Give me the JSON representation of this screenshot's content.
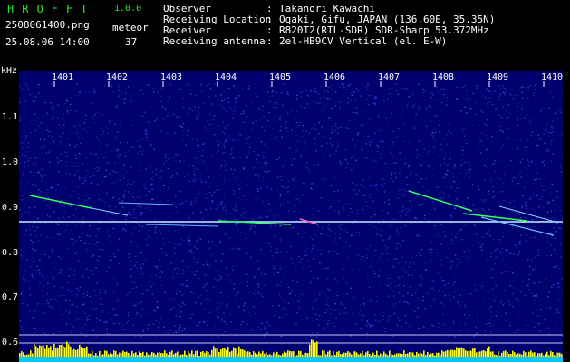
{
  "header": {
    "app_name": "HROFFT",
    "version": "1.0.0",
    "file_name": "2508061400.png",
    "datetime": "25.08.06 14:00",
    "meteor_label": "meteor",
    "meteor_count": "37",
    "info": [
      {
        "key": "Observer",
        "value": "Takanori Kawachi"
      },
      {
        "key": "Receiving Location",
        "value": "Ogaki, Gifu, JAPAN (136.60E, 35.35N)"
      },
      {
        "key": "Receiver",
        "value": "R820T2(RTL-SDR) SDR-Sharp 53.372MHz"
      },
      {
        "key": "Receiving antenna",
        "value": "2el-HB9CV Vertical (el. E-W)"
      }
    ]
  },
  "plot": {
    "y_unit": "kHz",
    "y_ticks": [
      "1.1",
      "1.0",
      "0.9",
      "0.8",
      "0.7",
      "0.6"
    ],
    "x_ticks": [
      "1401",
      "1402",
      "1403",
      "1404",
      "1405",
      "1406",
      "1407",
      "1408",
      "1409",
      "1410"
    ],
    "colors": {
      "background": "#00006e",
      "noise": "#3f5fff",
      "carrier": "#c8f0ff",
      "trace": "#30ff60",
      "histogram": "#ffff00",
      "baseline": "#00c8ff"
    }
  }
}
